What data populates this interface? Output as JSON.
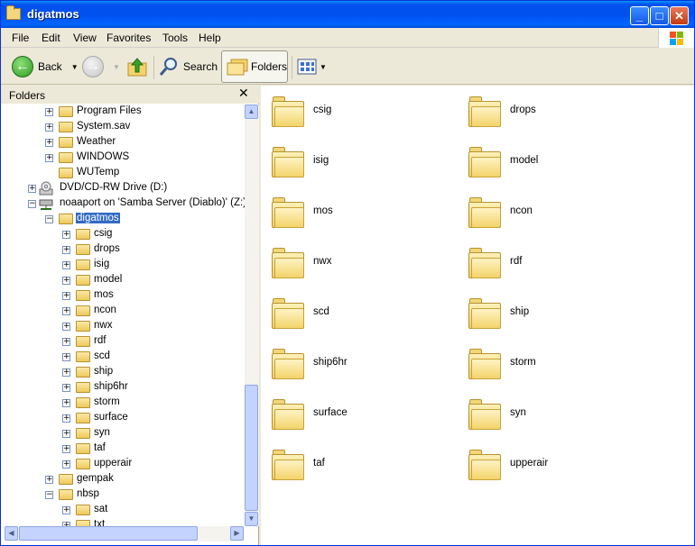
{
  "window": {
    "title": "digatmos"
  },
  "menu": [
    "File",
    "Edit",
    "View",
    "Favorites",
    "Tools",
    "Help"
  ],
  "toolbar": {
    "back_label": "Back",
    "search_label": "Search",
    "folders_label": "Folders"
  },
  "folders_pane": {
    "title": "Folders",
    "close_glyph": "✕"
  },
  "tree": [
    {
      "label": "Program Files",
      "level": 2,
      "expander": "+"
    },
    {
      "label": "System.sav",
      "level": 2,
      "expander": "+"
    },
    {
      "label": "Weather",
      "level": 2,
      "expander": "+"
    },
    {
      "label": "WINDOWS",
      "level": 2,
      "expander": "+"
    },
    {
      "label": "WUTemp",
      "level": 2,
      "expander": ""
    },
    {
      "label": "DVD/CD-RW Drive (D:)",
      "level": 1,
      "expander": "+",
      "icon": "dvd-drive-icon"
    },
    {
      "label": "noaaport on 'Samba Server (Diablo)' (Z:)",
      "level": 1,
      "expander": "−",
      "icon": "network-drive-icon"
    },
    {
      "label": "digatmos",
      "level": 2,
      "expander": "−",
      "selected": true
    },
    {
      "label": "csig",
      "level": 3,
      "expander": "+"
    },
    {
      "label": "drops",
      "level": 3,
      "expander": "+"
    },
    {
      "label": "isig",
      "level": 3,
      "expander": "+"
    },
    {
      "label": "model",
      "level": 3,
      "expander": "+"
    },
    {
      "label": "mos",
      "level": 3,
      "expander": "+"
    },
    {
      "label": "ncon",
      "level": 3,
      "expander": "+"
    },
    {
      "label": "nwx",
      "level": 3,
      "expander": "+"
    },
    {
      "label": "rdf",
      "level": 3,
      "expander": "+"
    },
    {
      "label": "scd",
      "level": 3,
      "expander": "+"
    },
    {
      "label": "ship",
      "level": 3,
      "expander": "+"
    },
    {
      "label": "ship6hr",
      "level": 3,
      "expander": "+"
    },
    {
      "label": "storm",
      "level": 3,
      "expander": "+"
    },
    {
      "label": "surface",
      "level": 3,
      "expander": "+"
    },
    {
      "label": "syn",
      "level": 3,
      "expander": "+"
    },
    {
      "label": "taf",
      "level": 3,
      "expander": "+"
    },
    {
      "label": "upperair",
      "level": 3,
      "expander": "+"
    },
    {
      "label": "gempak",
      "level": 2,
      "expander": "+"
    },
    {
      "label": "nbsp",
      "level": 2,
      "expander": "−"
    },
    {
      "label": "sat",
      "level": 3,
      "expander": "+"
    },
    {
      "label": "txt",
      "level": 3,
      "expander": "+"
    }
  ],
  "content": {
    "folders": [
      "csig",
      "drops",
      "isig",
      "model",
      "mos",
      "ncon",
      "nwx",
      "rdf",
      "scd",
      "ship",
      "ship6hr",
      "storm",
      "surface",
      "syn",
      "taf",
      "upperair"
    ]
  }
}
